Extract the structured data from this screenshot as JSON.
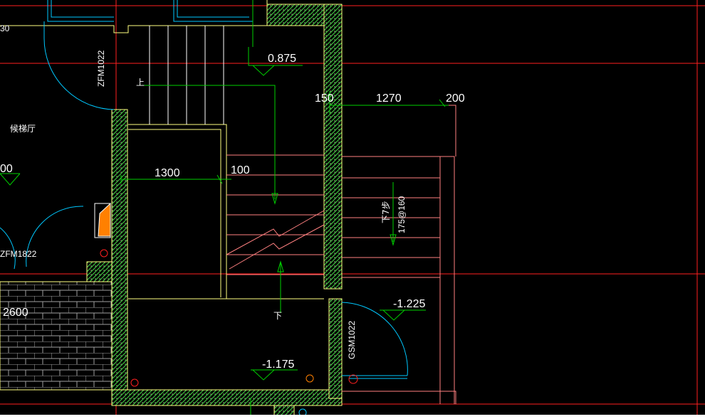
{
  "drawing": {
    "labels": {
      "corner_partial": "30",
      "door_top": "ZFM1022",
      "lobby": "候梯厅",
      "dim_left_partial": "00",
      "door_lower": "ZFM1822",
      "dim_left_bottom": "2600",
      "level_top": "0.875",
      "dim_150": "150",
      "dim_1270": "1270",
      "dim_200": "200",
      "dim_1300": "1300",
      "dim_100": "100",
      "up_mark": "上",
      "down_steps": "下7步",
      "step_spec": "175@160",
      "down_mark": "下",
      "level_right": "-1.225",
      "door_right": "GSM1022",
      "level_bottom": "-1.175"
    },
    "colors": {
      "background": "#000000",
      "grid_red": "#ff2020",
      "stair_salmon": "#ff8080",
      "wall_yellow": "#ffff80",
      "hatch_green": "#40c040",
      "dim_green": "#00d000",
      "door_cyan": "#00c8ff",
      "fill_orange": "#ff8000",
      "text_white": "#ffffff",
      "brick_gray": "#909090"
    }
  }
}
